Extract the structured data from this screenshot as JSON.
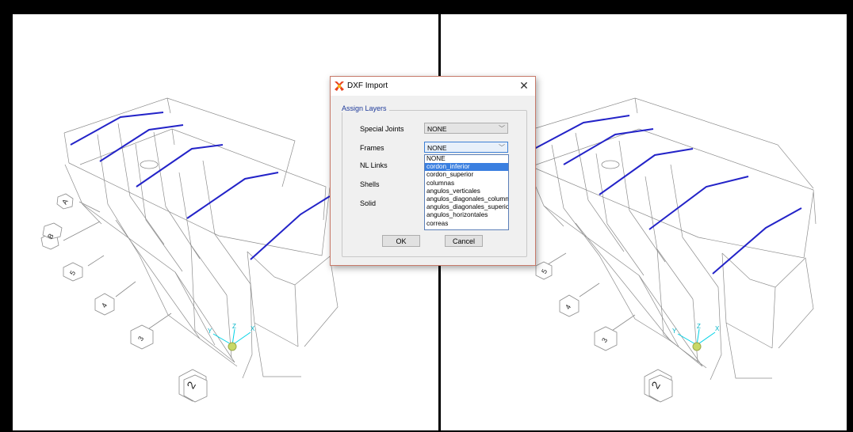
{
  "dialog": {
    "title": "DXF Import",
    "close_label": "✕",
    "group_label": "Assign Layers",
    "fields": [
      {
        "label": "Special Joints",
        "value": "NONE"
      },
      {
        "label": "Frames",
        "value": "NONE"
      },
      {
        "label": "NL Links"
      },
      {
        "label": "Shells"
      },
      {
        "label": "Solid"
      }
    ],
    "dropdown_options": [
      "NONE",
      "cordon_inferior",
      "cordon_superior",
      "columnas",
      "angulos_verticales",
      "angulos_diagonales_columnas",
      "angulos_diagonales_superior",
      "angulos_horizontales",
      "correas"
    ],
    "selected_option": "cordon_inferior",
    "ok_label": "OK",
    "cancel_label": "Cancel"
  },
  "grid_bubbles": {
    "left": [
      "A",
      "B",
      "5",
      "4",
      "3",
      "2"
    ],
    "right": [
      "5",
      "4",
      "3",
      "2"
    ]
  },
  "axes": {
    "x": "X",
    "y": "Y",
    "z": "Z"
  },
  "colors": {
    "frame_line": "#2323c8",
    "axis": "#00d2e6",
    "wire": "#8c8c8c",
    "selection": "#3a7fe0"
  }
}
